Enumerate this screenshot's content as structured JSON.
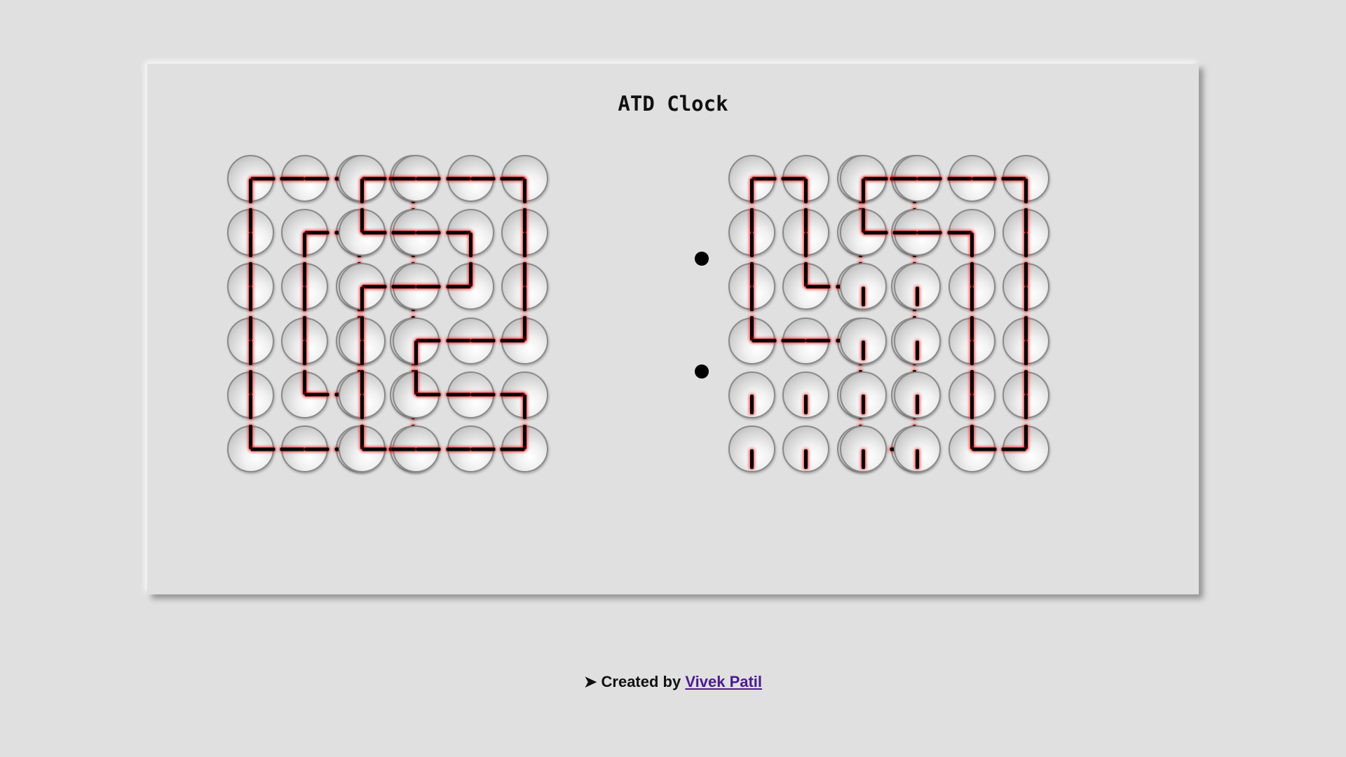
{
  "title": "ATD Clock",
  "footer": {
    "arrow": "➤",
    "prefix": "Created by",
    "author_link": "Vivek Patil"
  },
  "clock": {
    "hand_color": "#000000",
    "glow_color": "#ff0000",
    "digits_note": "Each digit is a 4x6 grid of clocks; each clock shows two hands pointing in directions (up/down/left/right).",
    "digits": [
      {
        "value": "0",
        "cells": [
          [
            "RD",
            "LR",
            "LR",
            "LD"
          ],
          [
            "UD",
            "RD",
            "LD",
            "UD"
          ],
          [
            "UD",
            "UD",
            "UD",
            "UD"
          ],
          [
            "UD",
            "UD",
            "UD",
            "UD"
          ],
          [
            "UD",
            "UR",
            "UL",
            "UD"
          ],
          [
            "UR",
            "LR",
            "LR",
            "UL"
          ]
        ]
      },
      {
        "value": "3",
        "cells": [
          [
            "RD",
            "LR",
            "LR",
            "LD"
          ],
          [
            "UR",
            "LR",
            "LD",
            "UD"
          ],
          [
            "RD",
            "LR",
            "UL",
            "UD"
          ],
          [
            "UD",
            "RD",
            "LR",
            "UL"
          ],
          [
            "UD",
            "UR",
            "LR",
            "LD"
          ],
          [
            "UR",
            "LR",
            "LR",
            "UL"
          ]
        ]
      },
      {
        "value": "4",
        "cells": [
          [
            "RD",
            "LD",
            "RD",
            "LD"
          ],
          [
            "UD",
            "UD",
            "UD",
            "UD"
          ],
          [
            "UD",
            "UR",
            "UL",
            "UD"
          ],
          [
            "UR",
            "LR",
            "LD",
            "UD"
          ],
          [
            "D",
            "D",
            "UD",
            "UD"
          ],
          [
            "D",
            "D",
            "UR",
            "UL"
          ]
        ]
      },
      {
        "value": "1",
        "cells": [
          [
            "RD",
            "LR",
            "LR",
            "LD"
          ],
          [
            "UR",
            "LR",
            "LD",
            "UD"
          ],
          [
            "D",
            "D",
            "UD",
            "UD"
          ],
          [
            "D",
            "D",
            "UD",
            "UD"
          ],
          [
            "D",
            "D",
            "UD",
            "UD"
          ],
          [
            "D",
            "D",
            "UR",
            "UL"
          ]
        ]
      }
    ]
  }
}
